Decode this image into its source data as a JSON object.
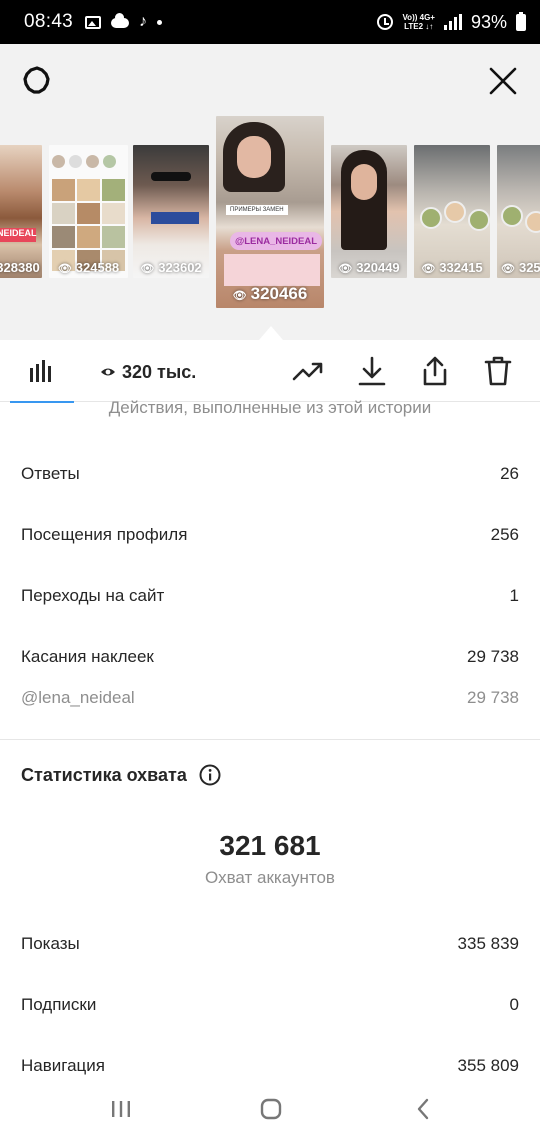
{
  "status_bar": {
    "time": "08:43",
    "network_top": "Vo)) 4G+",
    "network_bottom": "LTE2 ↓↑",
    "battery": "93%"
  },
  "stories": [
    {
      "views": "328380"
    },
    {
      "views": "324588"
    },
    {
      "views": "323602"
    },
    {
      "views": "320466",
      "sticker": "@LENA_NEIDEAL",
      "caption": "ПРИМЕРЫ ЗАМЕН",
      "active": true
    },
    {
      "views": "320449"
    },
    {
      "views": "332415"
    },
    {
      "views": "325"
    }
  ],
  "story_tag": "NEIDEAL",
  "toolbar": {
    "views_label": "320 тыс."
  },
  "actions": {
    "subtitle": "Действия, выполненные из этой истории",
    "rows": [
      {
        "label": "Ответы",
        "value": "26"
      },
      {
        "label": "Посещения профиля",
        "value": "256"
      },
      {
        "label": "Переходы на сайт",
        "value": "1"
      },
      {
        "label": "Касания наклеек",
        "value": "29 738"
      },
      {
        "label": "@lena_neideal",
        "value": "29 738"
      }
    ]
  },
  "reach": {
    "title": "Статистика охвата",
    "accounts_reached": "321 681",
    "accounts_reached_label": "Охват аккаунтов",
    "rows": [
      {
        "label": "Показы",
        "value": "335 839"
      },
      {
        "label": "Подписки",
        "value": "0"
      },
      {
        "label": "Навигация",
        "value": "355 809"
      }
    ]
  },
  "icons": {
    "settings": "settings-gear-icon",
    "close": "close-icon",
    "stats": "bar-chart-icon",
    "views": "eye-icon",
    "promote": "trending-up-icon",
    "download": "download-icon",
    "share": "share-icon",
    "delete": "trash-icon",
    "info": "info-icon"
  },
  "colors": {
    "accent": "#3897f0",
    "muted_text": "#8e8e8e",
    "sticker_pill": "#e9b7e6"
  }
}
